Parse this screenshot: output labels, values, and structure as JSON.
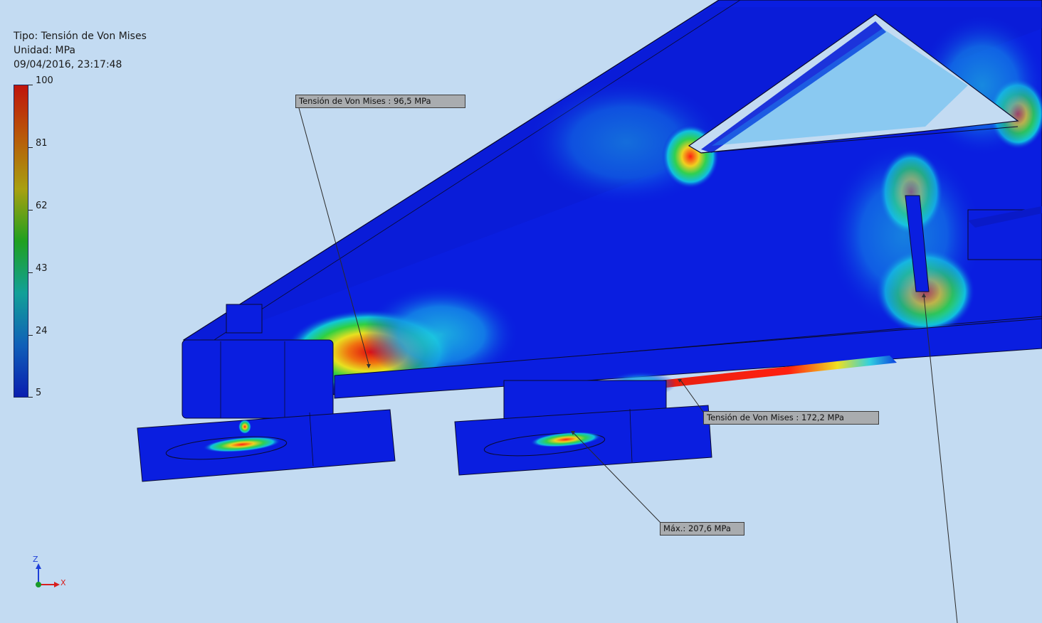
{
  "legend": {
    "type_line": "Tipo: Tensión de Von Mises",
    "unit_line": "Unidad: MPa",
    "datetime": "09/04/2016, 23:17:48",
    "ticks": [
      "100",
      "81",
      "62",
      "43",
      "24",
      "5"
    ],
    "colors": [
      "#c0140c",
      "#b85a0a",
      "#a8a010",
      "#20a020",
      "#12a098",
      "#1060b8",
      "#0a1eb0"
    ]
  },
  "probes": {
    "probe1": "Tensión de Von Mises : 96,5 MPa",
    "probe2": "Tensión de Von Mises : 172,2 MPa",
    "max": "Máx.: 207,6 MPa"
  },
  "triad": {
    "z_label": "Z",
    "x_label": "X",
    "z_color": "#1e3fd8",
    "x_color": "#d81e1e",
    "origin_color": "#1a9a2a"
  },
  "model": {
    "body_color": "#0a1ee0",
    "edge_color": "#0a0a30"
  }
}
